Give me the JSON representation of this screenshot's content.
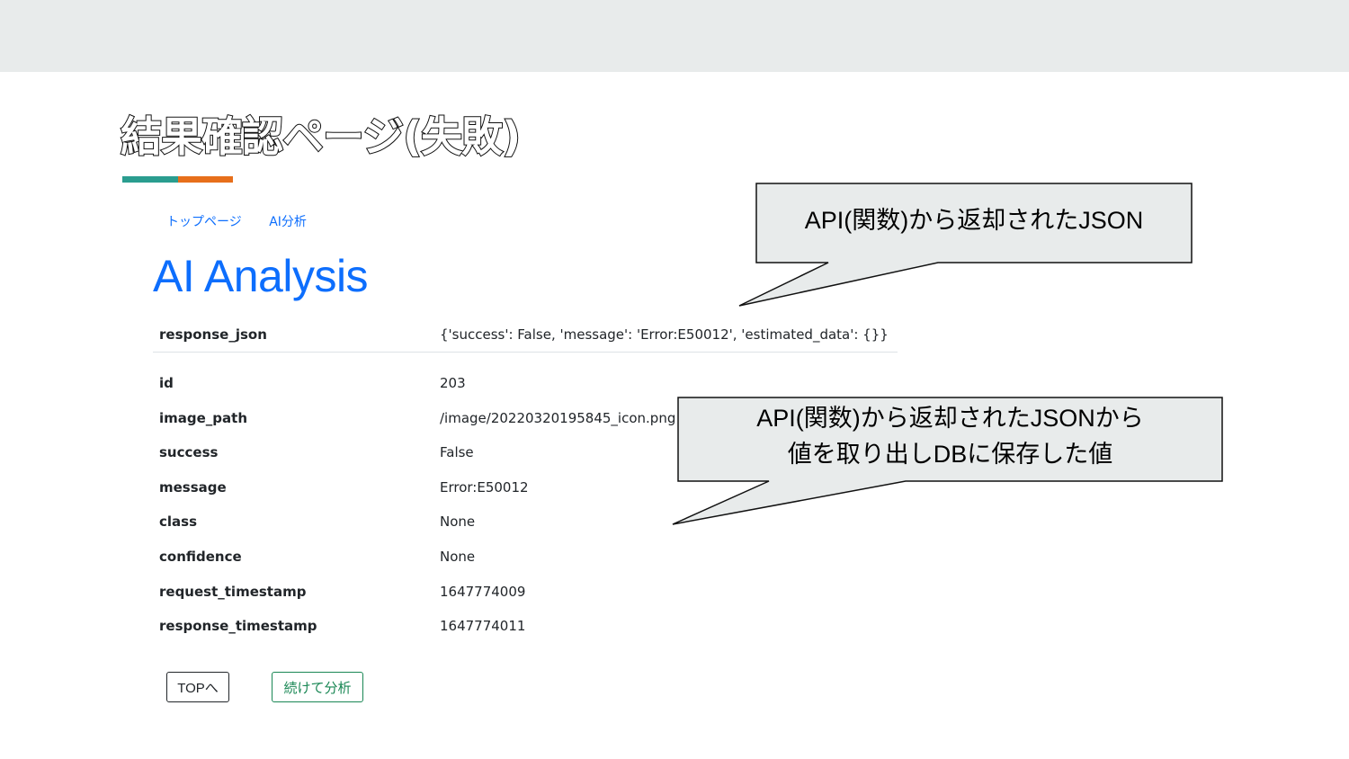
{
  "slide": {
    "title": "結果確認ページ(失敗)"
  },
  "colors": {
    "accent_teal": "#2a9d8f",
    "accent_orange": "#e76f1b",
    "link_blue": "#0d6efd",
    "success_green": "#198754",
    "callout_fill": "#e8ebeb"
  },
  "nav": {
    "items": [
      "トップページ",
      "AI分析"
    ]
  },
  "page": {
    "heading": "AI Analysis"
  },
  "response": {
    "key": "response_json",
    "value": "{'success': False, 'message': 'Error:E50012', 'estimated_data': {}}"
  },
  "record": {
    "rows": [
      {
        "key": "id",
        "value": "203"
      },
      {
        "key": "image_path",
        "value": "/image/20220320195845_icon.png"
      },
      {
        "key": "success",
        "value": "False"
      },
      {
        "key": "message",
        "value": "Error:E50012"
      },
      {
        "key": "class",
        "value": "None"
      },
      {
        "key": "confidence",
        "value": "None"
      },
      {
        "key": "request_timestamp",
        "value": "1647774009"
      },
      {
        "key": "response_timestamp",
        "value": "1647774011"
      }
    ]
  },
  "buttons": {
    "top": "TOPへ",
    "continue": "続けて分析"
  },
  "callouts": {
    "first": "API(関数)から返却されたJSON",
    "second_line1": "API(関数)から返却されたJSONから",
    "second_line2": "値を取り出しDBに保存した値"
  }
}
